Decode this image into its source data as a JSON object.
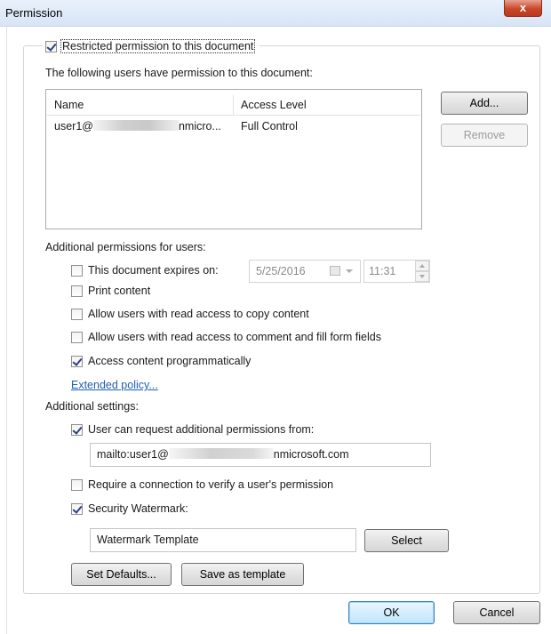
{
  "window": {
    "title": "Permission",
    "close_glyph": "x"
  },
  "restricted": {
    "label": "Restricted permission to this document",
    "checked": true
  },
  "users_section": {
    "label": "The following users have permission to this document:",
    "columns": [
      "Name",
      "Access Level"
    ],
    "rows": [
      {
        "name_prefix": "user1@",
        "name_suffix": "nmicro...",
        "access": "Full Control"
      }
    ]
  },
  "buttons": {
    "add": "Add...",
    "remove": "Remove",
    "select": "Select",
    "set_defaults": "Set Defaults...",
    "save_template": "Save as template",
    "ok": "OK",
    "cancel": "Cancel"
  },
  "additional_permissions": {
    "heading": "Additional permissions for users:",
    "expires_label": "This document expires on:",
    "expires_date": "5/25/2016",
    "expires_time": "11:31",
    "print": "Print content",
    "copy": "Allow users with read access to copy content",
    "comment": "Allow users with read access to comment and fill form fields",
    "programmatic": "Access content programmatically",
    "extended_policy": "Extended policy..."
  },
  "additional_settings": {
    "heading": "Additional settings:",
    "request_label": "User can request additional permissions from:",
    "request_prefix": "mailto:user1@",
    "request_suffix": "nmicrosoft.com",
    "require_connection": "Require a connection to verify a user's permission",
    "watermark_label": "Security Watermark:",
    "watermark_value": "Watermark Template"
  },
  "states": {
    "expires": false,
    "print": false,
    "copy": false,
    "comment": false,
    "programmatic": true,
    "request": true,
    "require": false,
    "watermark": true
  }
}
